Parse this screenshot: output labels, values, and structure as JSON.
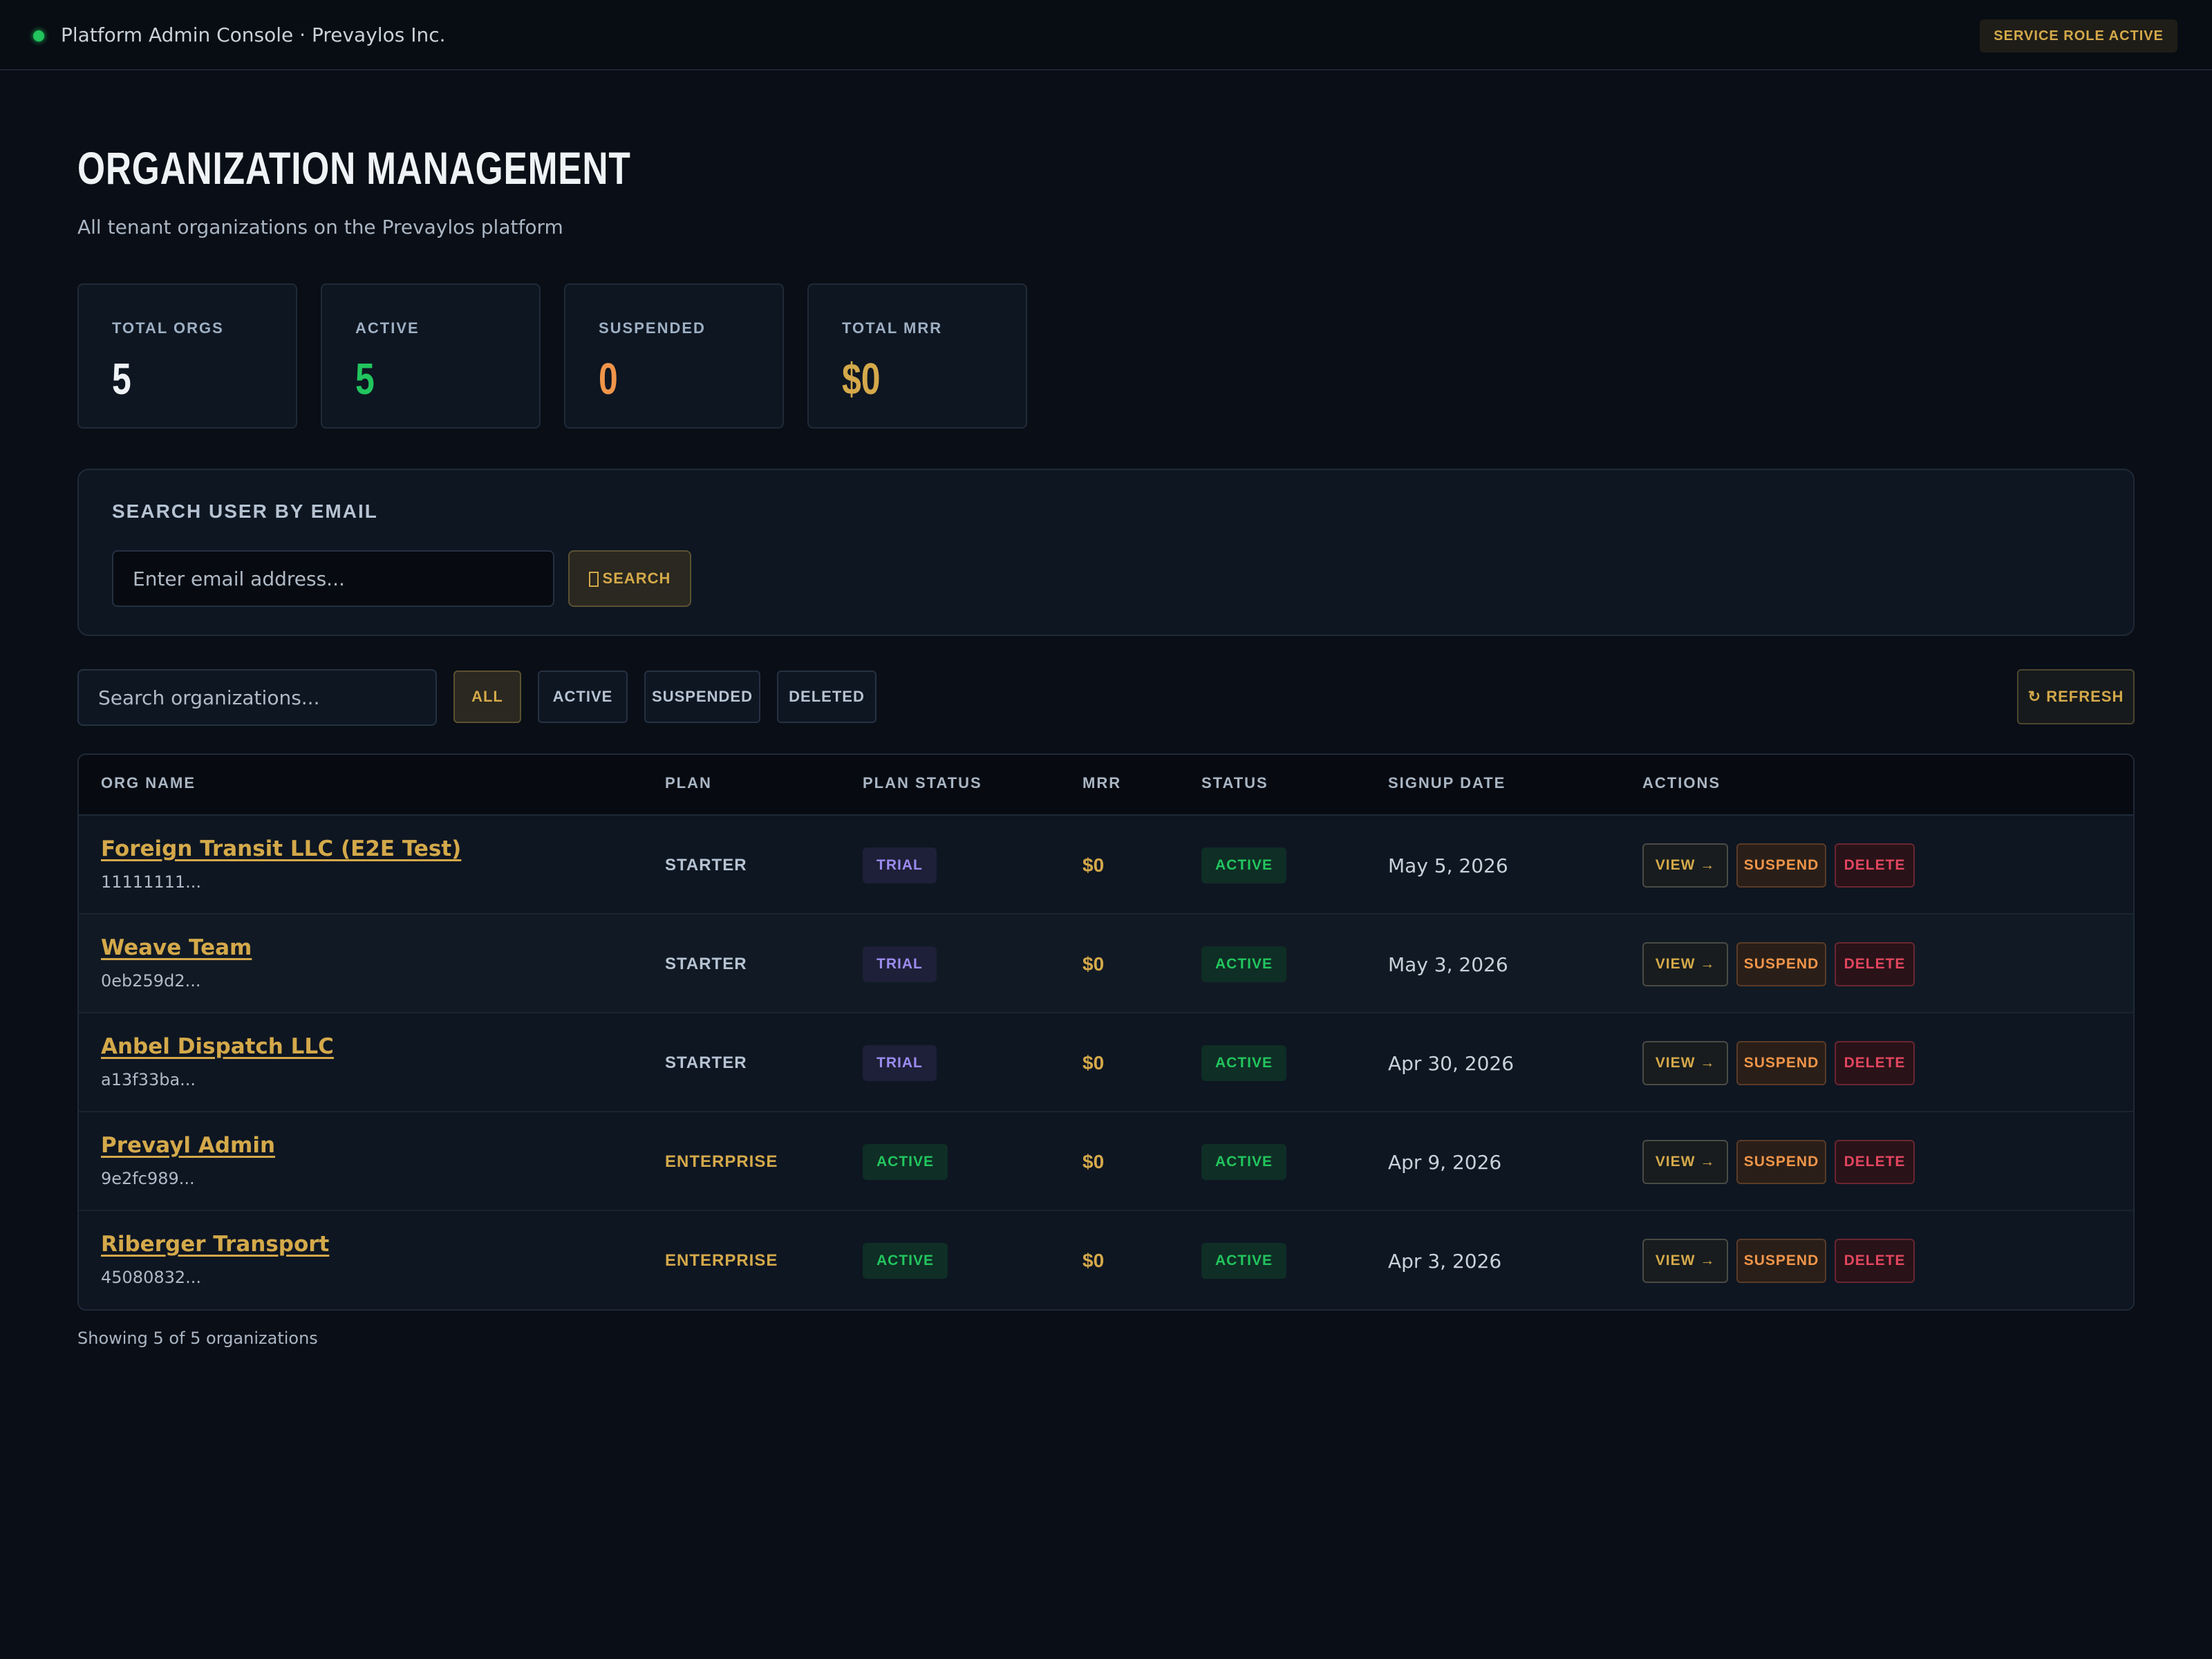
{
  "topbar": {
    "title": "Platform Admin Console · Prevaylos Inc.",
    "role_badge": "SERVICE ROLE ACTIVE"
  },
  "header": {
    "title": "ORGANIZATION MANAGEMENT",
    "subtitle": "All tenant organizations on the Prevaylos platform"
  },
  "stats": [
    {
      "label": "TOTAL ORGS",
      "value": "5",
      "color": "#f0f3f6"
    },
    {
      "label": "ACTIVE",
      "value": "5",
      "color": "#22c55e"
    },
    {
      "label": "SUSPENDED",
      "value": "0",
      "color": "#f0954a"
    },
    {
      "label": "TOTAL MRR",
      "value": "$0",
      "color": "#d4a94a"
    }
  ],
  "email_search": {
    "label": "SEARCH USER BY EMAIL",
    "placeholder": "Enter email address...",
    "button_label": "SEARCH"
  },
  "filters": {
    "search_placeholder": "Search organizations...",
    "buttons": [
      "ALL",
      "ACTIVE",
      "SUSPENDED",
      "DELETED"
    ],
    "selected": "ALL",
    "refresh_label": "↻ REFRESH"
  },
  "table": {
    "columns": [
      "ORG NAME",
      "PLAN",
      "PLAN STATUS",
      "MRR",
      "STATUS",
      "SIGNUP DATE",
      "ACTIONS"
    ],
    "rows": [
      {
        "name": "Foreign Transit LLC (E2E Test)",
        "id": "11111111...",
        "plan": "STARTER",
        "plan_status": "TRIAL",
        "mrr": "$0",
        "status": "ACTIVE",
        "signup_date": "May 5, 2026"
      },
      {
        "name": "Weave Team",
        "id": "0eb259d2...",
        "plan": "STARTER",
        "plan_status": "TRIAL",
        "mrr": "$0",
        "status": "ACTIVE",
        "signup_date": "May 3, 2026"
      },
      {
        "name": "Anbel Dispatch LLC",
        "id": "a13f33ba...",
        "plan": "STARTER",
        "plan_status": "TRIAL",
        "mrr": "$0",
        "status": "ACTIVE",
        "signup_date": "Apr 30, 2026"
      },
      {
        "name": "Prevayl Admin",
        "id": "9e2fc989...",
        "plan": "ENTERPRISE",
        "plan_status": "ACTIVE",
        "mrr": "$0",
        "status": "ACTIVE",
        "signup_date": "Apr 9, 2026"
      },
      {
        "name": "Riberger Transport",
        "id": "45080832...",
        "plan": "ENTERPRISE",
        "plan_status": "ACTIVE",
        "mrr": "$0",
        "status": "ACTIVE",
        "signup_date": "Apr 3, 2026"
      }
    ],
    "actions": {
      "view": "VIEW →",
      "suspend": "SUSPEND",
      "delete": "DELETE"
    }
  },
  "footer": {
    "summary": "Showing 5 of 5 organizations"
  }
}
